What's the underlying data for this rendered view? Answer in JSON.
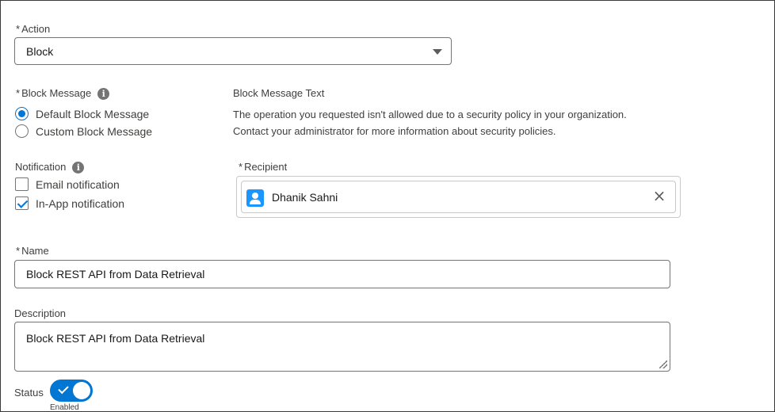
{
  "action": {
    "label": "Action",
    "required_mark": "*",
    "selected": "Block"
  },
  "block_message": {
    "label": "Block Message",
    "required_mark": "*",
    "info_icon": "info-icon",
    "options": [
      {
        "label": "Default Block Message",
        "checked": true
      },
      {
        "label": "Custom Block Message",
        "checked": false
      }
    ],
    "text_label": "Block Message Text",
    "text_lines": [
      "The operation you requested isn't allowed due to a security policy in your organization.",
      "Contact your administrator for more information about security policies."
    ]
  },
  "notification": {
    "label": "Notification",
    "info_icon": "info-icon",
    "options": [
      {
        "label": "Email notification",
        "checked": false
      },
      {
        "label": "In-App notification",
        "checked": true
      }
    ]
  },
  "recipient": {
    "label": "Recipient",
    "required_mark": "*",
    "name": "Dhanik Sahni",
    "avatar_icon": "user-icon",
    "remove_icon": "close-icon"
  },
  "name_field": {
    "label": "Name",
    "required_mark": "*",
    "value": "Block REST API from Data Retrieval"
  },
  "description_field": {
    "label": "Description",
    "value": "Block REST API from Data Retrieval"
  },
  "status": {
    "label": "Status",
    "state": "Enabled",
    "enabled": true
  },
  "colors": {
    "brand": "#0176d3",
    "avatar": "#1b96ff",
    "border": "#747474"
  }
}
